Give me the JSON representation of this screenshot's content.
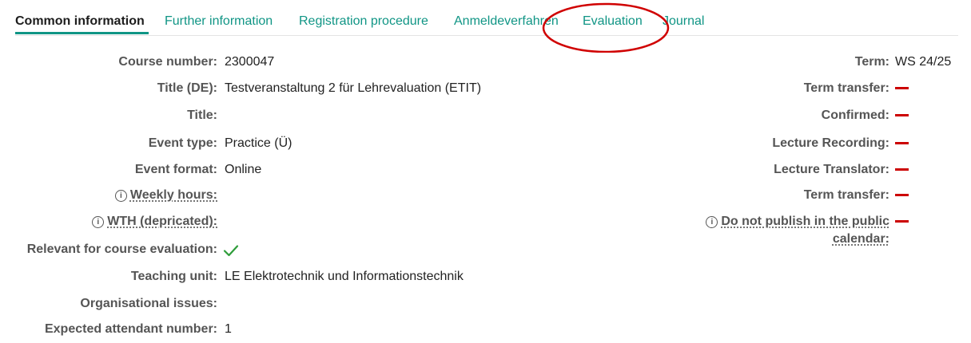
{
  "tabs": [
    {
      "label": "Common information",
      "active": true
    },
    {
      "label": "Further information",
      "active": false
    },
    {
      "label": "Registration procedure",
      "active": false
    },
    {
      "label": "Anmeldeverfahren",
      "active": false
    },
    {
      "label": "Evaluation",
      "active": false
    },
    {
      "label": "Journal",
      "active": false
    }
  ],
  "left": {
    "course_number": {
      "label": "Course number:",
      "value": "2300047"
    },
    "title_de": {
      "label": "Title (DE):",
      "value": "Testveranstaltung 2 für Lehrevaluation (ETIT)"
    },
    "title": {
      "label": "Title:",
      "value": ""
    },
    "event_type": {
      "label": "Event type:",
      "value": "Practice (Ü)"
    },
    "event_format": {
      "label": "Event format:",
      "value": "Online"
    },
    "weekly_hours": {
      "label": "Weekly hours:",
      "value": ""
    },
    "wth": {
      "label": "WTH (depricated):",
      "value": ""
    },
    "relevant_eval": {
      "label": "Relevant for course evaluation:",
      "value": "✓"
    },
    "teaching_unit": {
      "label": "Teaching unit:",
      "value": "LE Elektrotechnik und Informationstechnik"
    },
    "org_issues": {
      "label": "Organisational issues:",
      "value": ""
    },
    "expected_attendant": {
      "label": "Expected attendant number:",
      "value": "1"
    }
  },
  "right": {
    "term": {
      "label": "Term:",
      "value": "WS 24/25"
    },
    "term_transfer": {
      "label": "Term transfer:"
    },
    "confirmed": {
      "label": "Confirmed:"
    },
    "lecture_recording": {
      "label": "Lecture Recording:"
    },
    "lecture_translator": {
      "label": "Lecture Translator:"
    },
    "term_transfer_2": {
      "label": "Term transfer:"
    },
    "do_not_publish": {
      "label_line1": "Do not publish in the public",
      "label_line2": "calendar:"
    }
  },
  "info_icon_glyph": "i",
  "colors": {
    "accent": "#109585",
    "check": "#2e9d3a",
    "dash": "#cc0000",
    "ellipse": "#d00000"
  }
}
